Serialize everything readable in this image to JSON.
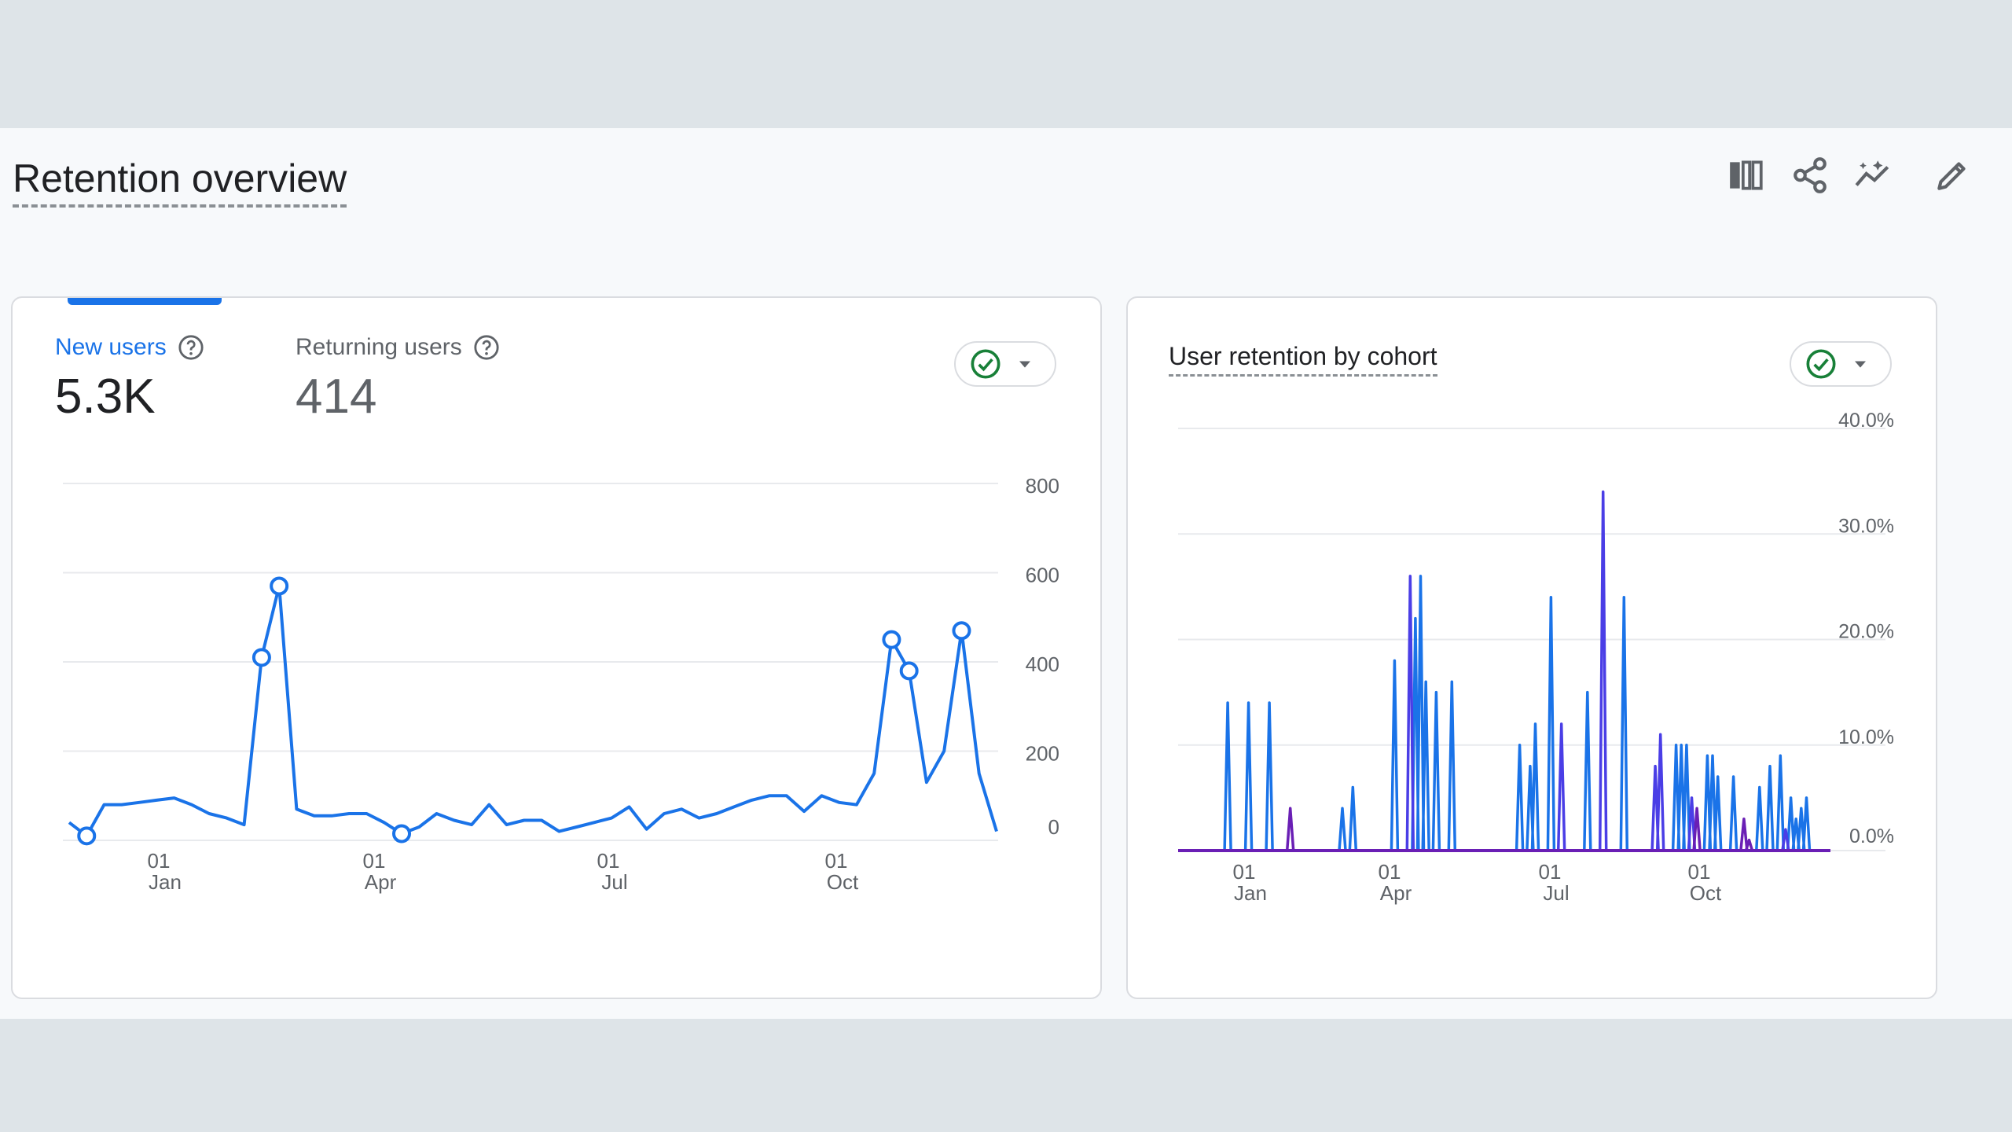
{
  "page": {
    "title": "Retention overview"
  },
  "toolbar": {
    "icons": [
      "compare-columns-icon",
      "share-icon",
      "insights-icon",
      "edit-icon"
    ]
  },
  "colors": {
    "blue": "#1a73e8",
    "purple": "#6a1fb5",
    "indigo": "#4a3ee6",
    "grid": "#e8eaed"
  },
  "card1": {
    "metrics": [
      {
        "label": "New users",
        "value": "5.3K"
      },
      {
        "label": "Returning users",
        "value": "414"
      }
    ]
  },
  "card2": {
    "title": "User retention by cohort"
  },
  "chart_data": [
    {
      "type": "line",
      "series": [
        {
          "name": "New users",
          "values": [
            40,
            10,
            80,
            80,
            85,
            90,
            95,
            80,
            60,
            50,
            35,
            410,
            570,
            70,
            55,
            55,
            60,
            60,
            40,
            15,
            30,
            60,
            45,
            35,
            80,
            35,
            45,
            45,
            20,
            30,
            40,
            50,
            75,
            25,
            60,
            70,
            50,
            60,
            75,
            90,
            100,
            100,
            65,
            100,
            85,
            80,
            150,
            450,
            380,
            130,
            200,
            470,
            150,
            20
          ],
          "markers": [
            1,
            11,
            12,
            19,
            47,
            48,
            51
          ]
        }
      ],
      "x_tick_labels": [
        [
          "01",
          "Jan"
        ],
        [
          "01",
          "Apr"
        ],
        [
          "01",
          "Jul"
        ],
        [
          "01",
          "Oct"
        ]
      ],
      "y_tick_labels": [
        "0",
        "200",
        "400",
        "600",
        "800"
      ],
      "ylim": [
        0,
        800
      ]
    },
    {
      "type": "line",
      "series": [
        {
          "name": "",
          "color": "#1a73e8",
          "spikes": [
            [
              8,
              14
            ],
            [
              12,
              14
            ],
            [
              16,
              14
            ],
            [
              30,
              4
            ],
            [
              32,
              6
            ],
            [
              40,
              18
            ],
            [
              44,
              22
            ],
            [
              45,
              26
            ],
            [
              46,
              16
            ],
            [
              48,
              15
            ],
            [
              51,
              16
            ],
            [
              64,
              10
            ],
            [
              66,
              8
            ],
            [
              67,
              12
            ],
            [
              70,
              24
            ],
            [
              77,
              15
            ],
            [
              84,
              24
            ],
            [
              94,
              10
            ],
            [
              95,
              10
            ],
            [
              96,
              10
            ],
            [
              100,
              9
            ],
            [
              101,
              9
            ],
            [
              102,
              7
            ],
            [
              105,
              7
            ],
            [
              110,
              6
            ],
            [
              112,
              8
            ],
            [
              114,
              9
            ],
            [
              116,
              5
            ],
            [
              117,
              3
            ],
            [
              118,
              4
            ],
            [
              119,
              5
            ]
          ]
        },
        {
          "name": "",
          "color": "#4a3ee6",
          "spikes": [
            [
              43,
              26
            ],
            [
              72,
              12
            ],
            [
              80,
              34
            ],
            [
              90,
              8
            ],
            [
              91,
              11
            ],
            [
              97,
              5
            ],
            [
              115,
              2
            ]
          ]
        },
        {
          "name": "",
          "color": "#6a1fb5",
          "spikes": [
            [
              20,
              4
            ],
            [
              98,
              4
            ],
            [
              107,
              3
            ],
            [
              108,
              1
            ]
          ]
        }
      ],
      "x_tick_labels": [
        [
          "01",
          "Jan"
        ],
        [
          "01",
          "Apr"
        ],
        [
          "01",
          "Jul"
        ],
        [
          "01",
          "Oct"
        ]
      ],
      "y_tick_labels": [
        "0.0%",
        "10.0%",
        "20.0%",
        "30.0%",
        "40.0%"
      ],
      "ylim": [
        0,
        40
      ]
    }
  ]
}
